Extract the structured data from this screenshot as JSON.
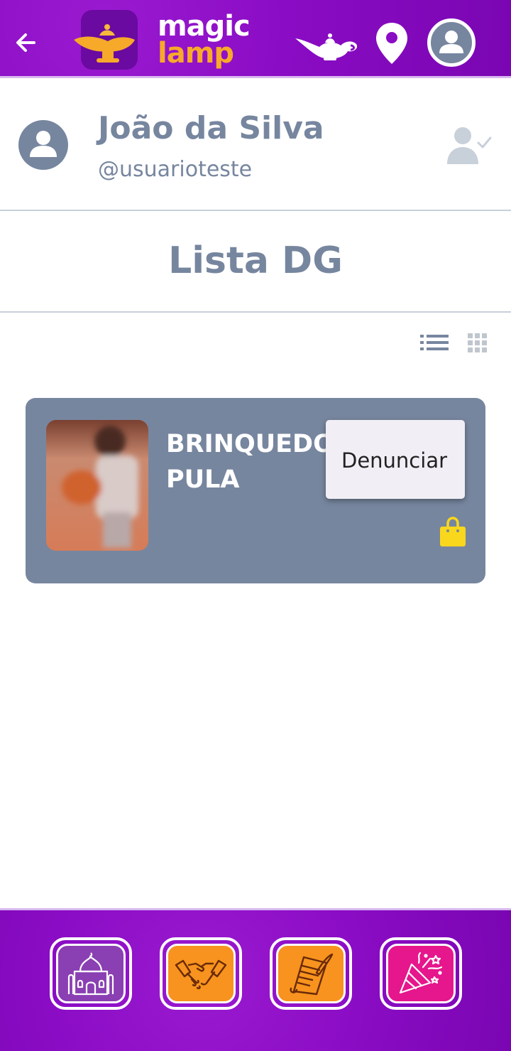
{
  "header": {
    "back_icon": "arrow-left-icon",
    "logo_line1": "magic",
    "logo_line2": "lamp",
    "lamp_icon": "magic-lamp-icon",
    "location_icon": "map-pin-icon",
    "account_icon": "user-avatar-icon",
    "brand_color": "#8a0cc4",
    "accent_color": "#f7a92a"
  },
  "profile": {
    "name": "João da Silva",
    "username": "@usuarioteste",
    "avatar_icon": "user-avatar-icon",
    "follow_icon": "user-check-icon"
  },
  "list": {
    "title": "Lista DG",
    "view_list_icon": "list-view-icon",
    "view_grid_icon": "grid-view-icon"
  },
  "card": {
    "title": "BRINQUEDO PULA",
    "image": "product-photo",
    "bag_icon": "shopping-bag-icon",
    "menu_option": "Denunciar"
  },
  "bottom_nav": {
    "items": [
      {
        "icon": "palace-icon",
        "color": "#8a3fb3"
      },
      {
        "icon": "handshake-icon",
        "color": "#f7931e"
      },
      {
        "icon": "scroll-quill-icon",
        "color": "#f7931e"
      },
      {
        "icon": "party-popper-icon",
        "color": "#e6168c"
      }
    ]
  }
}
